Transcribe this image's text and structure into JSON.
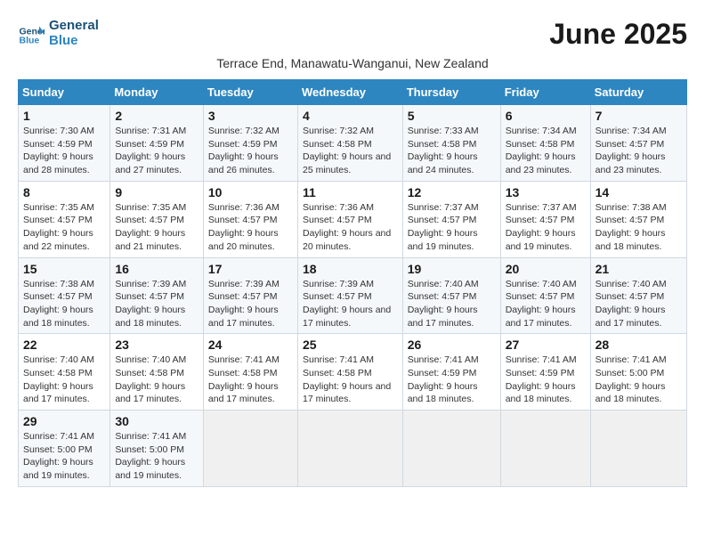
{
  "header": {
    "logo_line1": "General",
    "logo_line2": "Blue",
    "title": "June 2025",
    "subtitle": "Terrace End, Manawatu-Wanganui, New Zealand"
  },
  "weekdays": [
    "Sunday",
    "Monday",
    "Tuesday",
    "Wednesday",
    "Thursday",
    "Friday",
    "Saturday"
  ],
  "weeks": [
    [
      {
        "day": "1",
        "sunrise": "7:30 AM",
        "sunset": "4:59 PM",
        "daylight": "9 hours and 28 minutes."
      },
      {
        "day": "2",
        "sunrise": "7:31 AM",
        "sunset": "4:59 PM",
        "daylight": "9 hours and 27 minutes."
      },
      {
        "day": "3",
        "sunrise": "7:32 AM",
        "sunset": "4:59 PM",
        "daylight": "9 hours and 26 minutes."
      },
      {
        "day": "4",
        "sunrise": "7:32 AM",
        "sunset": "4:58 PM",
        "daylight": "9 hours and 25 minutes."
      },
      {
        "day": "5",
        "sunrise": "7:33 AM",
        "sunset": "4:58 PM",
        "daylight": "9 hours and 24 minutes."
      },
      {
        "day": "6",
        "sunrise": "7:34 AM",
        "sunset": "4:58 PM",
        "daylight": "9 hours and 23 minutes."
      },
      {
        "day": "7",
        "sunrise": "7:34 AM",
        "sunset": "4:57 PM",
        "daylight": "9 hours and 23 minutes."
      }
    ],
    [
      {
        "day": "8",
        "sunrise": "7:35 AM",
        "sunset": "4:57 PM",
        "daylight": "9 hours and 22 minutes."
      },
      {
        "day": "9",
        "sunrise": "7:35 AM",
        "sunset": "4:57 PM",
        "daylight": "9 hours and 21 minutes."
      },
      {
        "day": "10",
        "sunrise": "7:36 AM",
        "sunset": "4:57 PM",
        "daylight": "9 hours and 20 minutes."
      },
      {
        "day": "11",
        "sunrise": "7:36 AM",
        "sunset": "4:57 PM",
        "daylight": "9 hours and 20 minutes."
      },
      {
        "day": "12",
        "sunrise": "7:37 AM",
        "sunset": "4:57 PM",
        "daylight": "9 hours and 19 minutes."
      },
      {
        "day": "13",
        "sunrise": "7:37 AM",
        "sunset": "4:57 PM",
        "daylight": "9 hours and 19 minutes."
      },
      {
        "day": "14",
        "sunrise": "7:38 AM",
        "sunset": "4:57 PM",
        "daylight": "9 hours and 18 minutes."
      }
    ],
    [
      {
        "day": "15",
        "sunrise": "7:38 AM",
        "sunset": "4:57 PM",
        "daylight": "9 hours and 18 minutes."
      },
      {
        "day": "16",
        "sunrise": "7:39 AM",
        "sunset": "4:57 PM",
        "daylight": "9 hours and 18 minutes."
      },
      {
        "day": "17",
        "sunrise": "7:39 AM",
        "sunset": "4:57 PM",
        "daylight": "9 hours and 17 minutes."
      },
      {
        "day": "18",
        "sunrise": "7:39 AM",
        "sunset": "4:57 PM",
        "daylight": "9 hours and 17 minutes."
      },
      {
        "day": "19",
        "sunrise": "7:40 AM",
        "sunset": "4:57 PM",
        "daylight": "9 hours and 17 minutes."
      },
      {
        "day": "20",
        "sunrise": "7:40 AM",
        "sunset": "4:57 PM",
        "daylight": "9 hours and 17 minutes."
      },
      {
        "day": "21",
        "sunrise": "7:40 AM",
        "sunset": "4:57 PM",
        "daylight": "9 hours and 17 minutes."
      }
    ],
    [
      {
        "day": "22",
        "sunrise": "7:40 AM",
        "sunset": "4:58 PM",
        "daylight": "9 hours and 17 minutes."
      },
      {
        "day": "23",
        "sunrise": "7:40 AM",
        "sunset": "4:58 PM",
        "daylight": "9 hours and 17 minutes."
      },
      {
        "day": "24",
        "sunrise": "7:41 AM",
        "sunset": "4:58 PM",
        "daylight": "9 hours and 17 minutes."
      },
      {
        "day": "25",
        "sunrise": "7:41 AM",
        "sunset": "4:58 PM",
        "daylight": "9 hours and 17 minutes."
      },
      {
        "day": "26",
        "sunrise": "7:41 AM",
        "sunset": "4:59 PM",
        "daylight": "9 hours and 18 minutes."
      },
      {
        "day": "27",
        "sunrise": "7:41 AM",
        "sunset": "4:59 PM",
        "daylight": "9 hours and 18 minutes."
      },
      {
        "day": "28",
        "sunrise": "7:41 AM",
        "sunset": "5:00 PM",
        "daylight": "9 hours and 18 minutes."
      }
    ],
    [
      {
        "day": "29",
        "sunrise": "7:41 AM",
        "sunset": "5:00 PM",
        "daylight": "9 hours and 19 minutes."
      },
      {
        "day": "30",
        "sunrise": "7:41 AM",
        "sunset": "5:00 PM",
        "daylight": "9 hours and 19 minutes."
      },
      null,
      null,
      null,
      null,
      null
    ]
  ]
}
